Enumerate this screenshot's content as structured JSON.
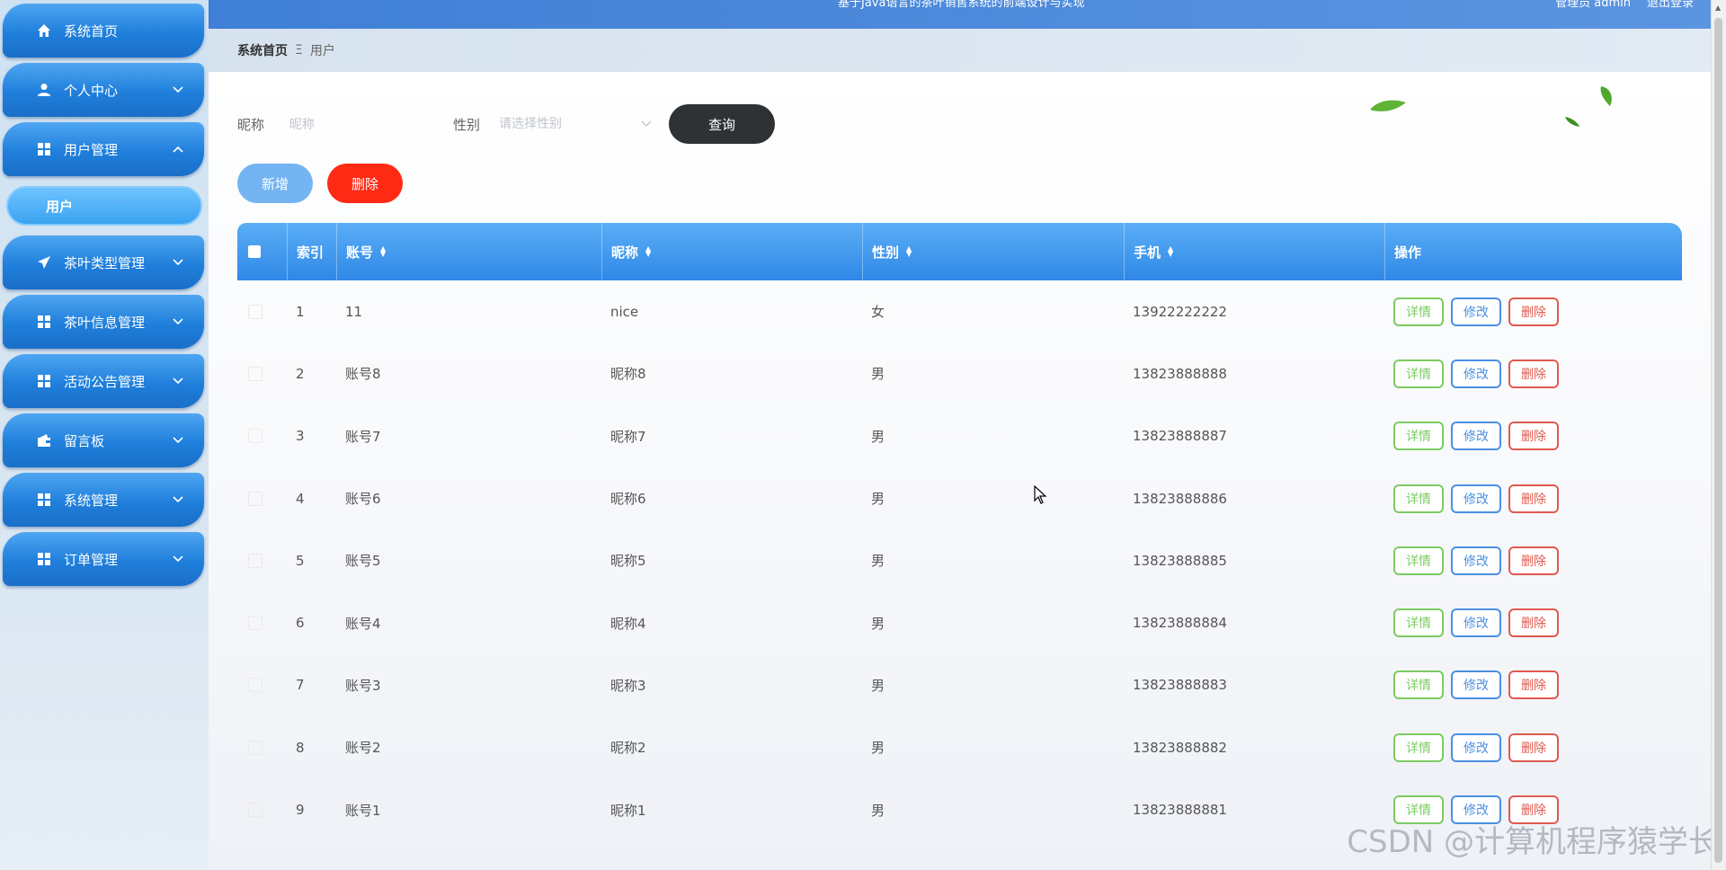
{
  "header": {
    "system_title": "基于Java语言的茶叶销售系统的前端设计与实现",
    "user_info": "管理员 admin",
    "logout": "退出登录"
  },
  "breadcrumb": {
    "home": "系统首页",
    "separator": "Ξ",
    "current": "用户"
  },
  "sidebar": {
    "items": [
      {
        "label": "系统首页",
        "icon": "home-icon"
      },
      {
        "label": "个人中心",
        "icon": "user-icon"
      },
      {
        "label": "用户管理",
        "icon": "grid-icon",
        "expanded": true
      },
      {
        "label": "茶叶类型管理",
        "icon": "send-icon"
      },
      {
        "label": "茶叶信息管理",
        "icon": "grid-icon"
      },
      {
        "label": "活动公告管理",
        "icon": "grid-icon"
      },
      {
        "label": "留言板",
        "icon": "wallet-icon"
      },
      {
        "label": "系统管理",
        "icon": "grid-icon"
      },
      {
        "label": "订单管理",
        "icon": "grid-icon"
      }
    ],
    "submenu": {
      "label": "用户"
    }
  },
  "search": {
    "nickname_label": "昵称",
    "nickname_placeholder": "昵称",
    "gender_label": "性别",
    "gender_placeholder": "请选择性别",
    "query_button": "查询"
  },
  "actions": {
    "add": "新增",
    "delete": "删除"
  },
  "table": {
    "columns": [
      "索引",
      "账号",
      "昵称",
      "性别",
      "手机",
      "操作"
    ],
    "op_labels": {
      "detail": "详情",
      "edit": "修改",
      "remove": "删除"
    },
    "rows": [
      {
        "index": "1",
        "account": "11",
        "nickname": "nice",
        "gender": "女",
        "phone": "13922222222"
      },
      {
        "index": "2",
        "account": "账号8",
        "nickname": "昵称8",
        "gender": "男",
        "phone": "13823888888"
      },
      {
        "index": "3",
        "account": "账号7",
        "nickname": "昵称7",
        "gender": "男",
        "phone": "13823888887"
      },
      {
        "index": "4",
        "account": "账号6",
        "nickname": "昵称6",
        "gender": "男",
        "phone": "13823888886"
      },
      {
        "index": "5",
        "account": "账号5",
        "nickname": "昵称5",
        "gender": "男",
        "phone": "13823888885"
      },
      {
        "index": "6",
        "account": "账号4",
        "nickname": "昵称4",
        "gender": "男",
        "phone": "13823888884"
      },
      {
        "index": "7",
        "account": "账号3",
        "nickname": "昵称3",
        "gender": "男",
        "phone": "13823888883"
      },
      {
        "index": "8",
        "account": "账号2",
        "nickname": "昵称2",
        "gender": "男",
        "phone": "13823888882"
      },
      {
        "index": "9",
        "account": "账号1",
        "nickname": "昵称1",
        "gender": "男",
        "phone": "13823888881"
      }
    ]
  },
  "watermark": "CSDN @计算机程序猿学长",
  "colors": {
    "sidebar_button": "#1f7fdb",
    "table_header": "#2f88e6",
    "query_button": "#2f3235",
    "add_button": "#74b4f2",
    "delete_button": "#ff2a14",
    "detail_outline": "#7ccb62",
    "edit_outline": "#4a90e2",
    "remove_outline": "#e05a4f"
  }
}
